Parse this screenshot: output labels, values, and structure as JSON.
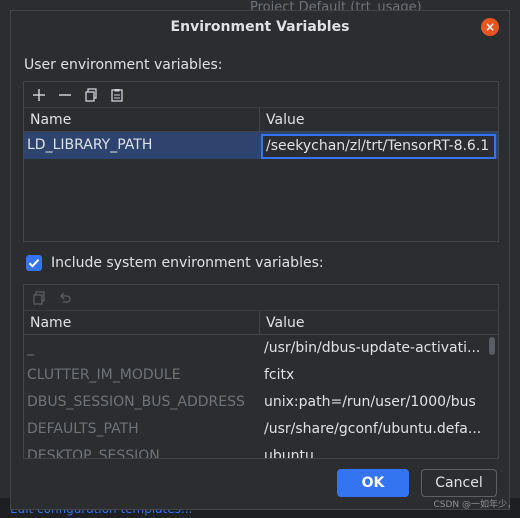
{
  "background": {
    "top_text": "Project Default (trt_usage)",
    "bottom_text": "Edit configuration templates..."
  },
  "dialog": {
    "title": "Environment Variables",
    "user_section_label": "User environment variables:",
    "columns": {
      "name": "Name",
      "value": "Value"
    },
    "user_rows": [
      {
        "name": "LD_LIBRARY_PATH",
        "value": "/seekychan/zl/trt/TensorRT-8.6.1"
      }
    ],
    "include_system_label": "Include system environment variables:",
    "include_system_checked": true,
    "system_rows": [
      {
        "name": "_",
        "value": "/usr/bin/dbus-update-activati..."
      },
      {
        "name": "CLUTTER_IM_MODULE",
        "value": "fcitx"
      },
      {
        "name": "DBUS_SESSION_BUS_ADDRESS",
        "value": "unix:path=/run/user/1000/bus"
      },
      {
        "name": "DEFAULTS_PATH",
        "value": "/usr/share/gconf/ubuntu.defa..."
      },
      {
        "name": "DESKTOP_SESSION",
        "value": "ubuntu"
      }
    ],
    "ok_label": "OK",
    "cancel_label": "Cancel",
    "close_glyph": "×"
  },
  "watermark": "CSDN @一如年少，",
  "colors": {
    "accent": "#3574f0",
    "close": "#e95420",
    "selection": "#2e436e",
    "background": "#2b2d30"
  }
}
